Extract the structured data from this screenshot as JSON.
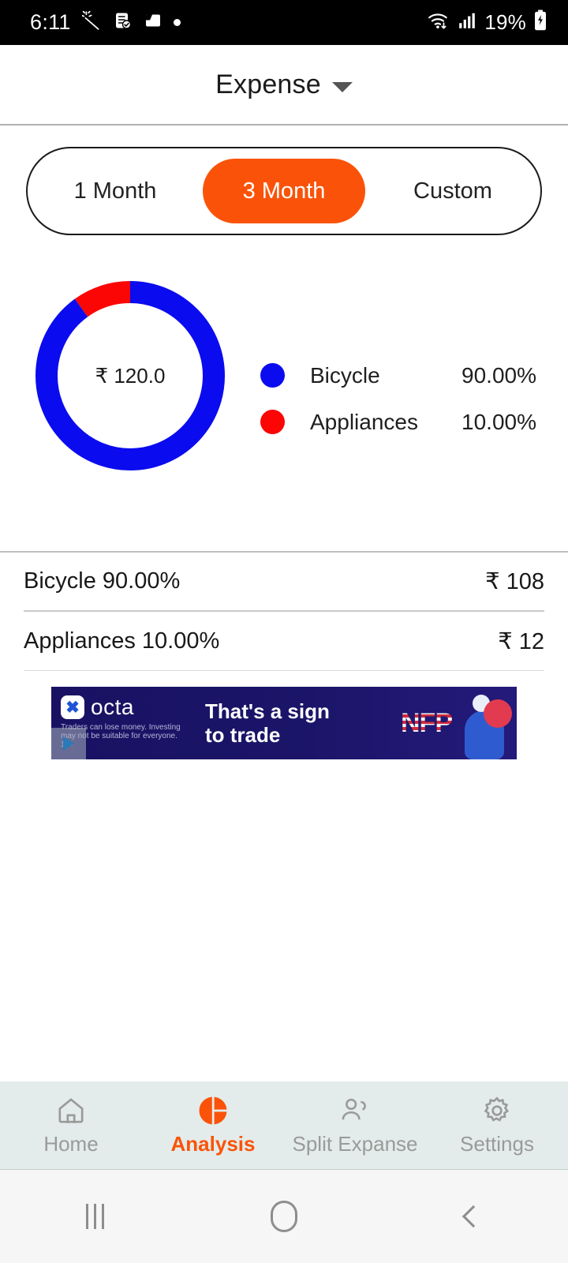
{
  "status_bar": {
    "time": "6:11",
    "battery_percent": "19%",
    "icons": [
      "magic-wand-icon",
      "note-check-icon",
      "card-icon",
      "dot-indicator",
      "wifi-icon",
      "signal-icon",
      "battery-charging-icon"
    ]
  },
  "header": {
    "title": "Expense",
    "dropdown_icon": "caret-down-icon"
  },
  "segment": {
    "options": [
      "1 Month",
      "3 Month",
      "Custom"
    ],
    "selected": "3 Month",
    "active_color": "#FA5309"
  },
  "chart_data": {
    "type": "pie",
    "title": "",
    "center_label": "₹ 120.0",
    "total": 120.0,
    "currency": "₹",
    "categories": [
      "Bicycle",
      "Appliances"
    ],
    "values": [
      108,
      12
    ],
    "percentages": [
      90.0,
      10.0
    ],
    "percent_labels": [
      "90.00%",
      "10.00%"
    ],
    "colors": [
      "#0B0BEF",
      "#FB0505"
    ],
    "legend_position": "right",
    "donut": true
  },
  "breakdown": {
    "rows": [
      {
        "label": "Bicycle 90.00%",
        "amount": "₹ 108"
      },
      {
        "label": "Appliances 10.00%",
        "amount": "₹ 12"
      }
    ]
  },
  "ad": {
    "brand": "octa",
    "logo_glyph": "✖",
    "headline_line1": "That's a sign",
    "headline_line2": "to trade",
    "badge": "NFP",
    "disclaimer": "Traders can lose money. Investing may not be suitable for everyone. 18+",
    "background_color": "#191263"
  },
  "bottom_nav": {
    "items": [
      {
        "label": "Home",
        "icon": "home-icon",
        "active": false
      },
      {
        "label": "Analysis",
        "icon": "pie-chart-icon",
        "active": true
      },
      {
        "label": "Split Expanse",
        "icon": "people-icon",
        "active": false
      },
      {
        "label": "Settings",
        "icon": "gear-icon",
        "active": false
      }
    ],
    "active_color": "#FA5309",
    "background_color": "#E3ECEA"
  },
  "android_nav": {
    "recents": "recents-button",
    "home": "home-button",
    "back": "back-button"
  }
}
